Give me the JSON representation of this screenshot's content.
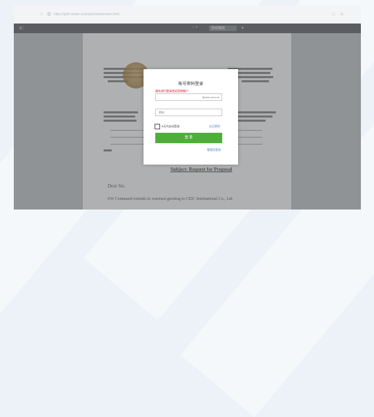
{
  "browser": {
    "url": "https://pdf.viewer.example/web/viewer.html"
  },
  "pdf_toolbar": {
    "zoom": "自动缩放"
  },
  "login_dialog": {
    "title": "帐号密码登录",
    "warning": "请先进行登录验证您的帐户",
    "username_suffix": "@ceic.com.cn",
    "password_placeholder": "密码",
    "remember_label": "5天内自动登录",
    "forgot_link": "忘记密码",
    "login_button": "登 录",
    "admin_link": "管理员登录"
  },
  "document": {
    "subject": "Subject: Request for Proposal",
    "salutation": "Dear Sir,",
    "body_line": "EW Command extends its warmest greeting to CEIC International Co., Ltd."
  },
  "colors": {
    "button_green": "#4fae3a",
    "link_blue": "#3d7ec3",
    "warning_red": "#d0021b"
  }
}
